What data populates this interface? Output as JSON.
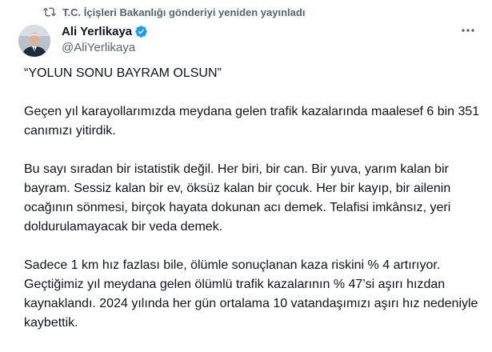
{
  "repost": {
    "icon": "repost-icon",
    "text": "T.C. İçişleri Bakanlığı gönderiyi yeniden yayınladı"
  },
  "author": {
    "display_name": "Ali Yerlikaya",
    "handle": "@AliYerlikaya",
    "verified_icon": "verified-badge-icon",
    "verified_color": "#1d9bf0"
  },
  "more_icon": "more-options-icon",
  "post": {
    "quote": "“YOLUN SONU BAYRAM OLSUN”",
    "paragraphs": [
      "Geçen yıl karayollarımızda meydana gelen trafik kazalarında maalesef 6 bin 351 canımızı yitirdik.",
      "Bu sayı sıradan bir istatistik değil. Her biri, bir can. Bir yuva, yarım kalan bir bayram. Sessiz kalan bir ev, öksüz kalan bir çocuk. Her bir kayıp, bir ailenin ocağının sönmesi, birçok hayata dokunan acı demek. Telafisi imkânsız, yeri doldurulamayacak bir veda demek.",
      "Sadece 1 km hız fazlası bile, ölümle sonuçlanan kaza riskini % 4 artırıyor. Geçtiğimiz yıl meydana gelen ölümlü trafik kazalarının % 47’si aşırı hızdan kaynaklandı. 2024 yılında her gün ortalama 10 vatandaşımızı aşırı hız nedeniyle kaybettik."
    ]
  }
}
